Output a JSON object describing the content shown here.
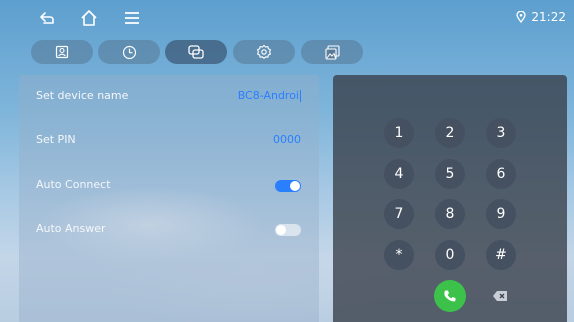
{
  "status": {
    "time": "21:22"
  },
  "settings": {
    "device_name_label": "Set device name",
    "device_name_value": "BC8-Androi",
    "pin_label": "Set PIN",
    "pin_value": "0000",
    "auto_connect_label": "Auto Connect",
    "auto_connect_on": true,
    "auto_answer_label": "Auto Answer",
    "auto_answer_on": false
  },
  "keypad": {
    "keys": [
      "1",
      "2",
      "3",
      "4",
      "5",
      "6",
      "7",
      "8",
      "9",
      "*",
      "0",
      "#"
    ]
  },
  "colors": {
    "accent": "#2a7fff",
    "toggle_on": "#2a7fff",
    "call_green": "#3cc24a"
  },
  "tabs": [
    "contacts-icon",
    "recents-icon",
    "transfer-icon",
    "settings-icon",
    "gallery-icon"
  ],
  "active_tab": "transfer-icon"
}
